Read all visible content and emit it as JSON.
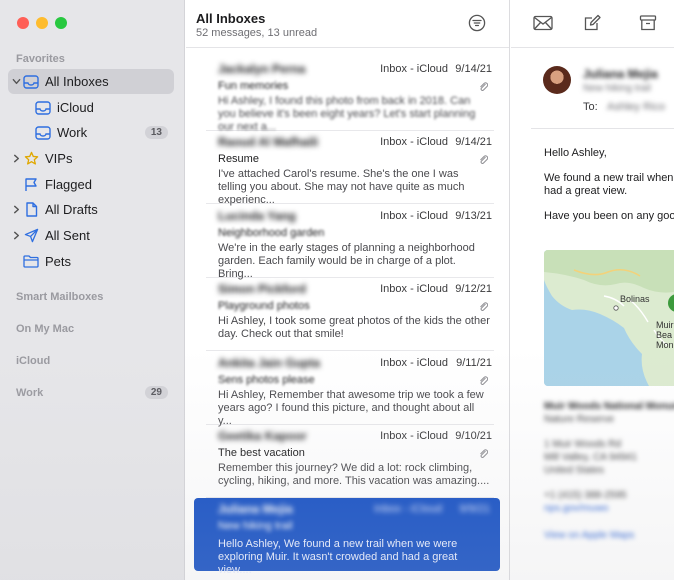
{
  "sidebar": {
    "sections": {
      "favorites": "Favorites",
      "smart_mailboxes": "Smart Mailboxes",
      "on_my_mac": "On My Mac",
      "icloud": "iCloud",
      "work": "Work",
      "work_count": "29"
    },
    "items": [
      {
        "label": "All Inboxes",
        "icon": "tray-icon",
        "selected": true
      },
      {
        "label": "iCloud",
        "icon": "tray-icon"
      },
      {
        "label": "Work",
        "icon": "tray-icon",
        "count": "13"
      },
      {
        "label": "VIPs",
        "icon": "star-icon"
      },
      {
        "label": "Flagged",
        "icon": "flag-icon"
      },
      {
        "label": "All Drafts",
        "icon": "document-icon"
      },
      {
        "label": "All Sent",
        "icon": "paperplane-icon"
      },
      {
        "label": "Pets",
        "icon": "folder-icon"
      }
    ]
  },
  "list": {
    "title": "All Inboxes",
    "subtitle": "52 messages, 13 unread",
    "messages": [
      {
        "sender": "Jackalyn Perna",
        "mailbox": "Inbox - iCloud",
        "date": "9/14/21",
        "subject": "Fun memories",
        "preview": "Hi Ashley, I found this photo from back in 2018. Can you believe it's been eight years? Let's start planning our next a..."
      },
      {
        "sender": "Raoud Al Mafhaili",
        "mailbox": "Inbox - iCloud",
        "date": "9/14/21",
        "subject": "Resume",
        "preview": "I've attached Carol's resume. She's the one I was telling you about. She may not have quite as much experienc..."
      },
      {
        "sender": "Lucinda Yang",
        "mailbox": "Inbox - iCloud",
        "date": "9/13/21",
        "subject": "Neighborhood garden",
        "preview": "We're in the early stages of planning a neighborhood garden. Each family would be in charge of a plot. Bring..."
      },
      {
        "sender": "Simon Pickford",
        "mailbox": "Inbox - iCloud",
        "date": "9/12/21",
        "subject": "Playground photos",
        "preview": "Hi Ashley, I took some great photos of the kids the other day. Check out that smile!"
      },
      {
        "sender": "Ankita Jain Gupta",
        "mailbox": "Inbox - iCloud",
        "date": "9/11/21",
        "subject": "Sens photos please",
        "preview": "Hi Ashley, Remember that awesome trip we took a few years ago? I found this picture, and thought about all y..."
      },
      {
        "sender": "Geetika Kapoor",
        "mailbox": "Inbox - iCloud",
        "date": "9/10/21",
        "subject": "The best vacation",
        "preview": "Remember this journey? We did a lot: rock climbing, cycling, hiking, and more. This vacation was amazing...."
      },
      {
        "sender": "Juliana Mejia",
        "mailbox": "Inbox - iCloud",
        "date": "9/9/21",
        "subject": "New hiking trail",
        "preview": "Hello Ashley, We found a new trail when we were exploring Muir. It wasn't crowded and had a great view....",
        "selected": true
      }
    ]
  },
  "reader": {
    "from_name": "Juliana Mejia",
    "from_sub": "New hiking trail",
    "to_label": "To:",
    "to_value": "Ashley Rico",
    "greeting": "Hello Ashley,",
    "line1": "We found a new trail when",
    "line2": "had a great view.",
    "line3": "Have you been on any goo",
    "map_labels": {
      "bolinas": "Bolinas",
      "muir": "Muir",
      "beach": "Bea",
      "mon": "Mon"
    },
    "location_name": "Muir Woods National Monument",
    "location_type": "Nature Reserve",
    "address1": "1 Muir Woods Rd",
    "address2": "Mill Valley, CA 94941",
    "address3": "United States",
    "phone": "+1 (415) 388-2595",
    "website": "nps.gov/muwo",
    "maps_link": "View on Apple Maps"
  },
  "colors": {
    "selection": "#1550c5",
    "accent": "#2a62d4",
    "sidebar_bg": "#e6e6e9",
    "close": "#ff5f57",
    "minimize": "#febc2e",
    "zoom": "#28c840"
  }
}
